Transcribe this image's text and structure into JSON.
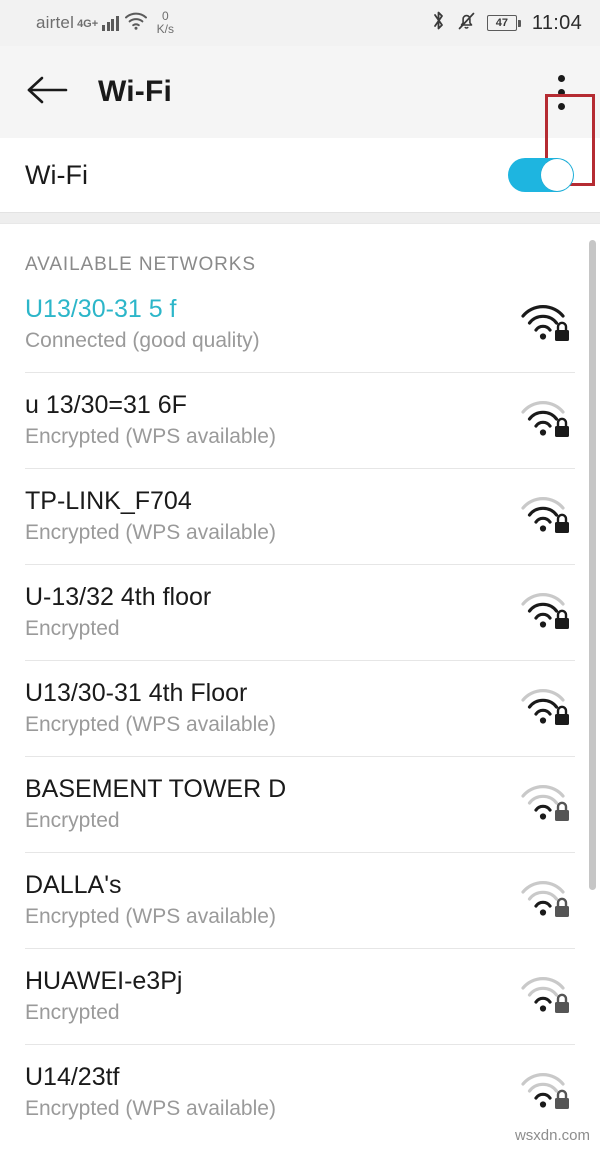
{
  "status_bar": {
    "carrier": "airtel",
    "network_type": "4G+",
    "signal_bars": 4,
    "wifi_icon": "wifi-icon",
    "data_rate_value": "0",
    "data_rate_unit": "K/s",
    "bluetooth_icon": "bluetooth-icon",
    "mute_icon": "bell-muted-icon",
    "battery_percent": "47",
    "time": "11:04"
  },
  "app_bar": {
    "back_icon": "back-arrow-icon",
    "title": "Wi-Fi",
    "overflow_icon": "overflow-menu-icon",
    "annotation_color": "#b52b32"
  },
  "wifi_toggle": {
    "label": "Wi-Fi",
    "state": "on",
    "accent_color": "#1eb5e0"
  },
  "list": {
    "section_header": "AVAILABLE NETWORKS",
    "connected_color": "#2cb6c9",
    "networks": [
      {
        "ssid": "U13/30-31 5 f",
        "status": "Connected (good quality)",
        "connected": true,
        "signal": 3,
        "secured": true
      },
      {
        "ssid": "u 13/30=31 6F",
        "status": "Encrypted (WPS available)",
        "connected": false,
        "signal": 2,
        "secured": true
      },
      {
        "ssid": "TP-LINK_F704",
        "status": "Encrypted (WPS available)",
        "connected": false,
        "signal": 2,
        "secured": true
      },
      {
        "ssid": "U-13/32 4th floor",
        "status": "Encrypted",
        "connected": false,
        "signal": 2,
        "secured": true
      },
      {
        "ssid": "U13/30-31 4th Floor",
        "status": "Encrypted (WPS available)",
        "connected": false,
        "signal": 2,
        "secured": true
      },
      {
        "ssid": "BASEMENT TOWER D",
        "status": "Encrypted",
        "connected": false,
        "signal": 1,
        "secured": true
      },
      {
        "ssid": "DALLA's",
        "status": "Encrypted (WPS available)",
        "connected": false,
        "signal": 1,
        "secured": true
      },
      {
        "ssid": "HUAWEI-e3Pj",
        "status": "Encrypted",
        "connected": false,
        "signal": 1,
        "secured": true
      },
      {
        "ssid": "U14/23tf",
        "status": "Encrypted (WPS available)",
        "connected": false,
        "signal": 1,
        "secured": true
      }
    ]
  },
  "watermark": "wsxdn.com"
}
